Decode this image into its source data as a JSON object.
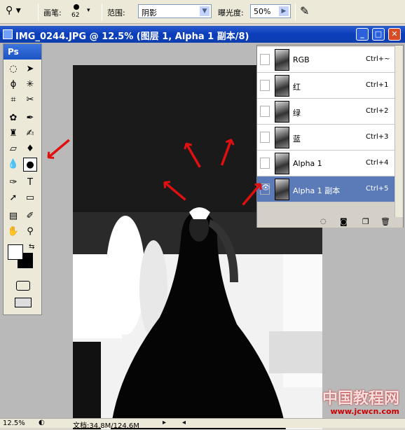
{
  "options_bar": {
    "brush_label": "画笔:",
    "brush_size": "62",
    "range_label": "范围:",
    "range_value": "阴影",
    "exposure_label": "曝光度:",
    "exposure_value": "50%"
  },
  "document": {
    "title": "IMG_0244.JPG @ 12.5% (图层 1, Alpha 1 副本/8)",
    "minimize": "_",
    "maximize": "□",
    "close": "✕"
  },
  "toolbox": {
    "header": "Ps"
  },
  "channels": [
    {
      "name": "RGB",
      "shortcut": "Ctrl+~",
      "visible": false,
      "selected": false
    },
    {
      "name": "红",
      "shortcut": "Ctrl+1",
      "visible": false,
      "selected": false
    },
    {
      "name": "绿",
      "shortcut": "Ctrl+2",
      "visible": false,
      "selected": false
    },
    {
      "name": "蓝",
      "shortcut": "Ctrl+3",
      "visible": false,
      "selected": false
    },
    {
      "name": "Alpha 1",
      "shortcut": "Ctrl+4",
      "visible": false,
      "selected": false
    },
    {
      "name": "Alpha 1 副本",
      "shortcut": "Ctrl+5",
      "visible": true,
      "selected": true
    }
  ],
  "status": {
    "zoom": "12.5%",
    "doc_info": "文档:34.8M/124.6M"
  },
  "watermark": {
    "line1": "中国教程网",
    "line2": "www.jcwcn.com"
  }
}
